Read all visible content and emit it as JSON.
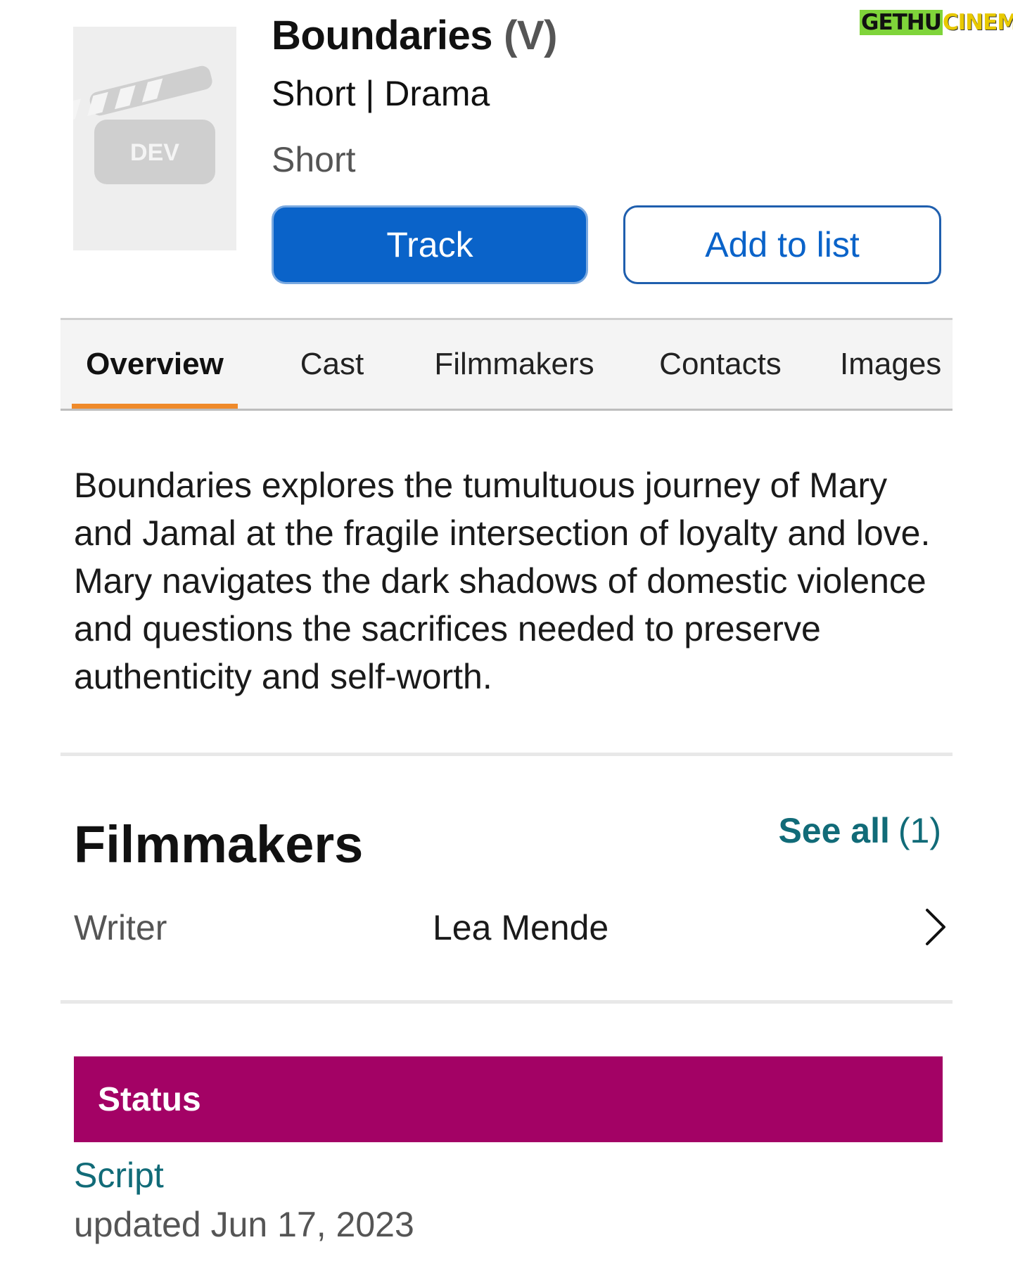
{
  "watermark": {
    "part1": "GETHU",
    "part2": "CINEMA"
  },
  "poster": {
    "label": "DEV"
  },
  "title": {
    "name": "Boundaries",
    "type": "(V)"
  },
  "genres": "Short | Drama",
  "subtype": "Short",
  "actions": {
    "track_label": "Track",
    "add_to_list_label": "Add to list"
  },
  "tabs": [
    {
      "label": "Overview",
      "active": true
    },
    {
      "label": "Cast"
    },
    {
      "label": "Filmmakers"
    },
    {
      "label": "Contacts"
    },
    {
      "label": "Images"
    }
  ],
  "overview": {
    "text": "Boundaries explores the tumultuous journey of Mary and Jamal at the fragile intersection of loyalty and love. Mary navigates the dark shadows of domestic violence and questions the sacrifices needed to preserve authenticity and self-worth."
  },
  "filmmakers": {
    "title": "Filmmakers",
    "see_all_label": "See all",
    "see_all_count": "(1)",
    "crew": [
      {
        "role": "Writer",
        "name": "Lea Mende"
      }
    ]
  },
  "status": {
    "heading": "Status",
    "value": "Script",
    "updated": "updated Jun 17, 2023"
  },
  "colors": {
    "primary_button": "#0a63c9",
    "tab_underline": "#ef8a2a",
    "status_bar": "#a30265",
    "link_teal": "#116b78"
  }
}
